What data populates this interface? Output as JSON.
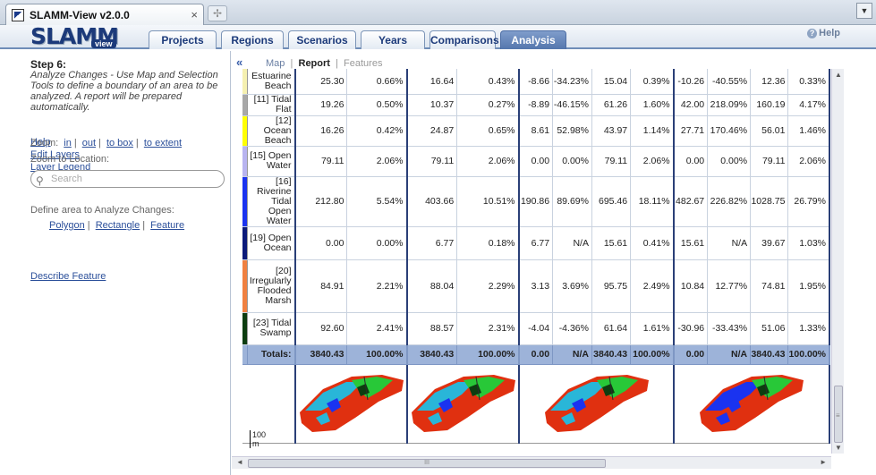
{
  "browser": {
    "tab_title": "SLAMM-View v2.0.0",
    "close_glyph": "×",
    "newtab_glyph": "✢",
    "menu_glyph": "▼"
  },
  "app": {
    "logo": "SLAMM",
    "logo_sub": "view",
    "help": "Help"
  },
  "nav_tabs": [
    {
      "label": "Projects"
    },
    {
      "label": "Regions"
    },
    {
      "label": "Scenarios"
    },
    {
      "label": "Years"
    },
    {
      "label": "Comparisons"
    },
    {
      "label": "Analysis"
    }
  ],
  "left": {
    "step_title": "Step 6:",
    "step_desc": "Analyze Changes - Use Map and Selection Tools to define a boundary of an area to be analyzed. A report will be prepared automatically.",
    "links": [
      "Help",
      "Edit Layers",
      "Layer Legend"
    ],
    "zoom_label": "Zoom:",
    "zoom_in": "in",
    "zoom_out": "out",
    "zoom_box": "to box",
    "zoom_extent": "to extent",
    "zoom_location": "Zoom to Location:",
    "search_placeholder": "Search",
    "define_label": "Define area to Analyze Changes:",
    "polygon": "Polygon",
    "rectangle": "Rectangle",
    "feature": "Feature",
    "describe": "Describe Feature"
  },
  "right": {
    "collapse": "«",
    "subtab_map": "Map",
    "subtab_report": "Report",
    "subtab_features": "Features"
  },
  "rows": [
    {
      "cat": "Estuarine\nBeach",
      "color": "#f5f0b0",
      "v": [
        "25.30",
        "0.66%",
        "16.64",
        "0.43%",
        "-8.66",
        "-34.23%",
        "15.04",
        "0.39%",
        "-10.26",
        "-40.55%",
        "12.36",
        "0.33%"
      ]
    },
    {
      "cat": "[11] Tidal Flat",
      "color": "#a8a8a8",
      "v": [
        "19.26",
        "0.50%",
        "10.37",
        "0.27%",
        "-8.89",
        "-46.15%",
        "61.26",
        "1.60%",
        "42.00",
        "218.09%",
        "160.19",
        "4.17%"
      ]
    },
    {
      "cat": "[12] Ocean\nBeach",
      "color": "#ffff00",
      "v": [
        "16.26",
        "0.42%",
        "24.87",
        "0.65%",
        "8.61",
        "52.98%",
        "43.97",
        "1.14%",
        "27.71",
        "170.46%",
        "56.01",
        "1.46%"
      ]
    },
    {
      "cat": "[15] Open\nWater",
      "color": "#b8b4f0",
      "v": [
        "79.11",
        "2.06%",
        "79.11",
        "2.06%",
        "0.00",
        "0.00%",
        "79.11",
        "2.06%",
        "0.00",
        "0.00%",
        "79.11",
        "2.06%"
      ]
    },
    {
      "cat": "[16] Riverine\nTidal Open\nWater",
      "color": "#1a33f0",
      "v": [
        "212.80",
        "5.54%",
        "403.66",
        "10.51%",
        "190.86",
        "89.69%",
        "695.46",
        "18.11%",
        "482.67",
        "226.82%",
        "1028.75",
        "26.79%"
      ]
    },
    {
      "cat": "[19] Open\nOcean",
      "color": "#0b1a7a",
      "v": [
        "0.00",
        "0.00%",
        "6.77",
        "0.18%",
        "6.77",
        "N/A",
        "15.61",
        "0.41%",
        "15.61",
        "N/A",
        "39.67",
        "1.03%"
      ]
    },
    {
      "cat": "[20]\nIrregularly\nFlooded\nMarsh",
      "color": "#f08040",
      "v": [
        "84.91",
        "2.21%",
        "88.04",
        "2.29%",
        "3.13",
        "3.69%",
        "95.75",
        "2.49%",
        "10.84",
        "12.77%",
        "74.81",
        "1.95%"
      ]
    },
    {
      "cat": "[23] Tidal\nSwamp",
      "color": "#0d3d10",
      "v": [
        "92.60",
        "2.41%",
        "88.57",
        "2.31%",
        "-4.04",
        "-4.36%",
        "61.64",
        "1.61%",
        "-30.96",
        "-33.43%",
        "51.06",
        "1.33%"
      ]
    }
  ],
  "totals": {
    "label": "Totals:",
    "v": [
      "3840.43",
      "100.00%",
      "3840.43",
      "100.00%",
      "0.00",
      "N/A",
      "3840.43",
      "100.00%",
      "0.00",
      "N/A",
      "3840.43",
      "100.00%"
    ]
  },
  "scale_label": "100\nm",
  "scroll": {
    "up": "▲",
    "down": "▼",
    "left": "◄",
    "right": "►",
    "grip": "III",
    "vgrip": "≡"
  }
}
